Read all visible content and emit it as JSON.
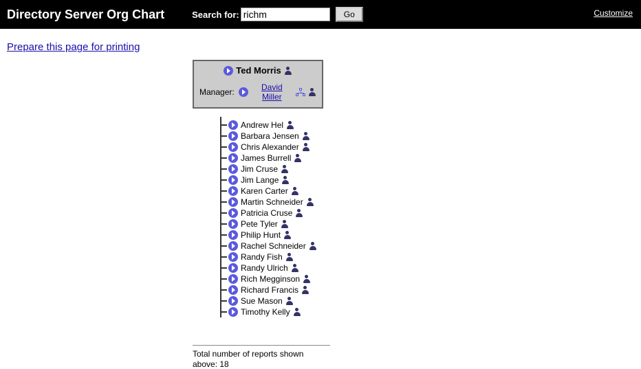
{
  "header": {
    "title": "Directory Server Org Chart",
    "search_label": "Search for:",
    "search_value": "richm",
    "go_label": "Go",
    "customize_label": "Customize"
  },
  "print_link": "Prepare this page for printing",
  "current": {
    "name": "Ted Morris",
    "manager_label": "Manager:",
    "manager_name": "David Miller"
  },
  "reports": [
    {
      "name": "Andrew Hel"
    },
    {
      "name": "Barbara Jensen"
    },
    {
      "name": "Chris Alexander"
    },
    {
      "name": "James Burrell"
    },
    {
      "name": "Jim Cruse"
    },
    {
      "name": "Jim Lange"
    },
    {
      "name": "Karen Carter"
    },
    {
      "name": "Martin Schneider"
    },
    {
      "name": "Patricia Cruse"
    },
    {
      "name": "Pete Tyler"
    },
    {
      "name": "Philip Hunt"
    },
    {
      "name": "Rachel Schneider"
    },
    {
      "name": "Randy Fish"
    },
    {
      "name": "Randy Ulrich"
    },
    {
      "name": "Rich Megginson"
    },
    {
      "name": "Richard Francis"
    },
    {
      "name": "Sue Mason"
    },
    {
      "name": "Timothy Kelly"
    }
  ],
  "footer": {
    "total_label": "Total number of reports shown above:",
    "total_count": "18"
  }
}
